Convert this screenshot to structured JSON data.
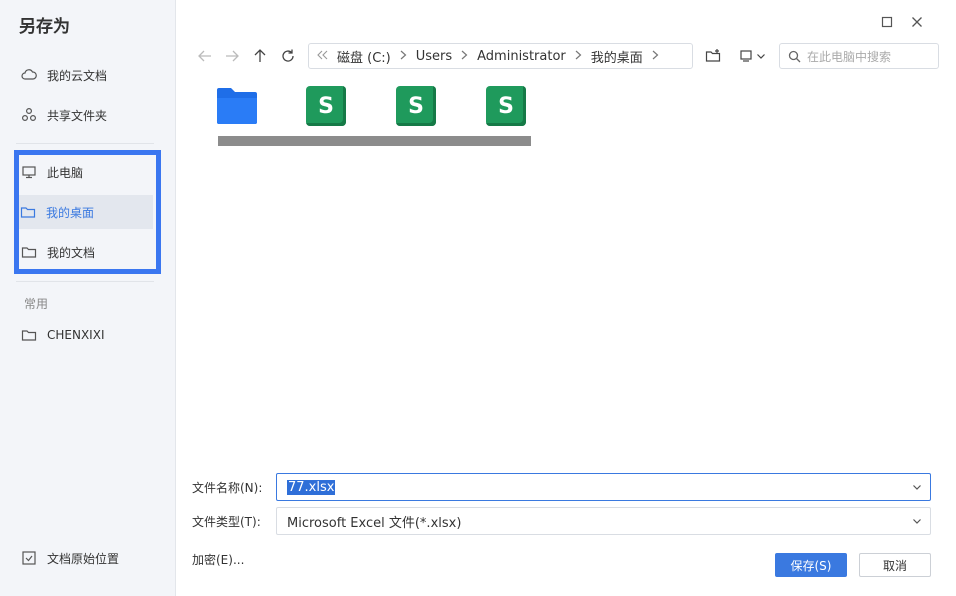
{
  "dialog": {
    "title": "另存为"
  },
  "sidebar": {
    "items": [
      {
        "label": "我的云文档",
        "icon": "cloud-doc-icon"
      },
      {
        "label": "共享文件夹",
        "icon": "share-icon"
      },
      {
        "label": "此电脑",
        "icon": "computer-icon"
      },
      {
        "label": "我的桌面",
        "icon": "folder-icon"
      },
      {
        "label": "我的文档",
        "icon": "folder-icon"
      }
    ],
    "section_label": "常用",
    "frequent": [
      {
        "label": "CHENXIXI",
        "icon": "folder-icon"
      }
    ],
    "original_location": "文档原始位置"
  },
  "breadcrumb": [
    "磁盘 (C:)",
    "Users",
    "Administrator",
    "我的桌面"
  ],
  "search": {
    "placeholder": "在此电脑中搜索"
  },
  "form": {
    "filename_label": "文件名称(N):",
    "filename_value": "77.xlsx",
    "filetype_label": "文件类型(T):",
    "filetype_value": "Microsoft Excel 文件(*.xlsx)",
    "encrypt_label": "加密(E)..."
  },
  "buttons": {
    "save": "保存(S)",
    "cancel": "取消"
  },
  "file_icons": [
    "S",
    "S",
    "S"
  ],
  "colors": {
    "accent": "#3a79e0",
    "highlight": "#3a76f0",
    "sheet_green": "#1f9a5c",
    "folder_blue": "#2a7cf6"
  }
}
